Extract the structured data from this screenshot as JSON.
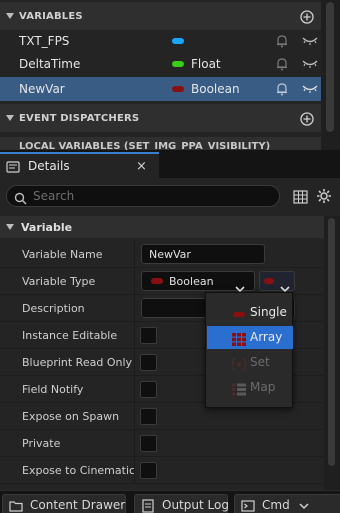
{
  "my_blueprint": {
    "variables_header": "VARIABLES",
    "variables": [
      {
        "name": "TXT_FPS",
        "type": "",
        "color": "#1aa6ff"
      },
      {
        "name": "DeltaTime",
        "type": "Float",
        "color": "#35d116"
      },
      {
        "name": "NewVar",
        "type": "Boolean",
        "color": "#8a0f10",
        "selected": true
      }
    ],
    "event_dispatchers_header": "EVENT DISPATCHERS",
    "local_variables_header": "LOCAL VARIABLES (SET_IMG_PPA_VISIBILITY)"
  },
  "details_tab": {
    "label": "Details",
    "close_glyph": "×"
  },
  "details": {
    "search_placeholder": "Search",
    "category": "Variable",
    "props": {
      "variable_name_label": "Variable Name",
      "variable_name_value": "NewVar",
      "variable_type_label": "Variable Type",
      "variable_type_value": "Boolean",
      "description_label": "Description",
      "instance_editable_label": "Instance Editable",
      "blueprint_read_only_label": "Blueprint Read Only",
      "field_notify_label": "Field Notify",
      "expose_on_spawn_label": "Expose on Spawn",
      "private_label": "Private",
      "expose_to_cinematics_label": "Expose to Cinematics"
    }
  },
  "container_dropdown": {
    "items": [
      {
        "label": "Single",
        "state": "normal"
      },
      {
        "label": "Array",
        "state": "highlighted"
      },
      {
        "label": "Set",
        "state": "disabled"
      },
      {
        "label": "Map",
        "state": "disabled"
      }
    ]
  },
  "bottom_bar": {
    "content_drawer": "Content Drawer",
    "output_log": "Output Log",
    "cmd": "Cmd"
  },
  "colors": {
    "accent": "#2a6ed0",
    "selection": "#395c85",
    "boolean_pin": "#8a0f10",
    "float_pin": "#35d116",
    "text_pin": "#1aa6ff"
  }
}
